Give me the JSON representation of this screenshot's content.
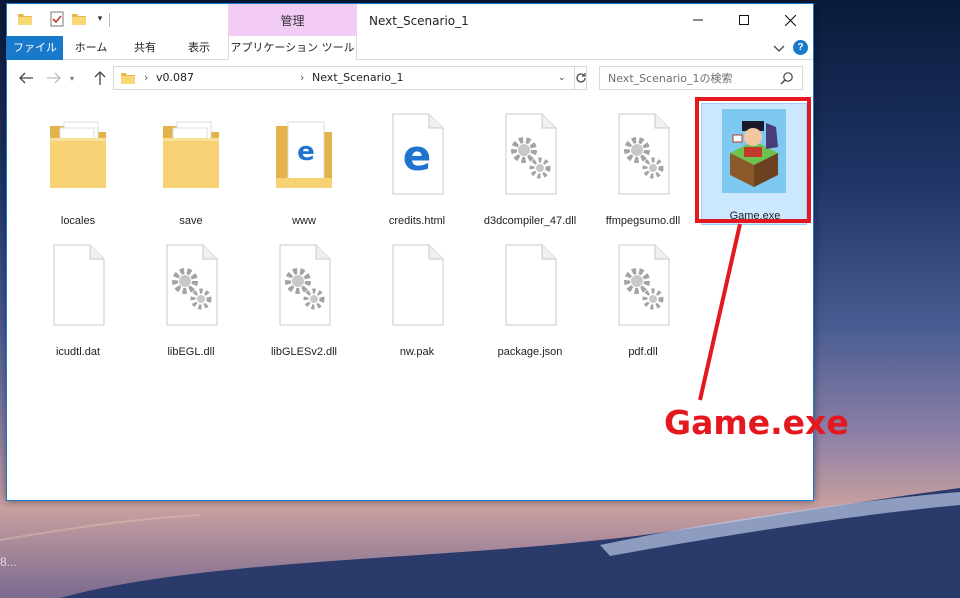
{
  "window": {
    "title": "Next_Scenario_1",
    "contextual_header": "管理"
  },
  "ribbon": {
    "tabs": [
      "ファイル",
      "ホーム",
      "共有",
      "表示",
      "アプリケーション ツール"
    ]
  },
  "navigation": {
    "breadcrumb": [
      "v0.087",
      "Next_Scenario_1"
    ],
    "search_placeholder": "Next_Scenario_1の検索"
  },
  "files": [
    {
      "name": "locales",
      "type": "folder"
    },
    {
      "name": "save",
      "type": "folder"
    },
    {
      "name": "www",
      "type": "folder-edge"
    },
    {
      "name": "credits.html",
      "type": "edge"
    },
    {
      "name": "d3dcompiler_47.dll",
      "type": "dll"
    },
    {
      "name": "ffmpegsumo.dll",
      "type": "dll"
    },
    {
      "name": "Game.exe",
      "type": "exe",
      "selected": true
    },
    {
      "name": "icudtl.dat",
      "type": "blank"
    },
    {
      "name": "libEGL.dll",
      "type": "dll"
    },
    {
      "name": "libGLESv2.dll",
      "type": "dll"
    },
    {
      "name": "nw.pak",
      "type": "blank"
    },
    {
      "name": "package.json",
      "type": "blank"
    },
    {
      "name": "pdf.dll",
      "type": "dll"
    }
  ],
  "annotation": {
    "label": "Game.exe",
    "color": "#e3191f"
  },
  "icons": {
    "folder": "folder-icon",
    "dll": "gear-file-icon",
    "edge": "edge-icon",
    "blank": "blank-file-icon",
    "exe": "game-app-icon"
  },
  "colors": {
    "accent": "#1979ca",
    "contextual_tab": "#f2ccf4",
    "selection": "#cce8ff",
    "annotation": "#e3191f"
  }
}
